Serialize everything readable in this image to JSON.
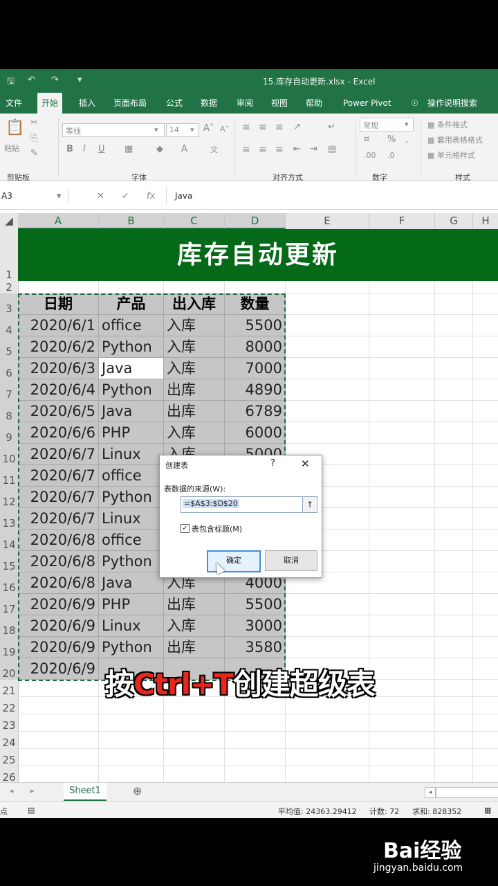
{
  "window": {
    "title": "15.库存自动更新.xlsx - Excel"
  },
  "tabs": [
    "文件",
    "开始",
    "插入",
    "页面布局",
    "公式",
    "数据",
    "审阅",
    "视图",
    "帮助",
    "Power Pivot",
    "操作说明搜索"
  ],
  "ribbon": {
    "font_name": "等线",
    "font_size": "14",
    "groups": [
      "剪贴板",
      "字体",
      "对齐方式",
      "数字",
      "样式"
    ],
    "paste_label": "粘贴",
    "number_format": "常规",
    "style_buttons": [
      "条件格式",
      "套用表格格式",
      "单元格样式"
    ]
  },
  "formula_bar": {
    "name_box": "A3",
    "formula": "Java"
  },
  "columns": [
    "A",
    "B",
    "C",
    "D",
    "E",
    "F",
    "G",
    "H"
  ],
  "rows": [
    "1",
    "2",
    "3",
    "4",
    "5",
    "6",
    "7",
    "8",
    "9",
    "10",
    "11",
    "12",
    "13",
    "14",
    "15",
    "16",
    "17",
    "18",
    "19",
    "20",
    "21",
    "22",
    "23",
    "24",
    "25",
    "26"
  ],
  "banner": "库存自动更新",
  "table": {
    "headers": [
      "日期",
      "产品",
      "出入库",
      "数量"
    ],
    "rows": [
      [
        "2020/6/1",
        "office",
        "入库",
        "5500"
      ],
      [
        "2020/6/2",
        "Python",
        "入库",
        "8000"
      ],
      [
        "2020/6/3",
        "Java",
        "入库",
        "7000"
      ],
      [
        "2020/6/4",
        "Python",
        "出库",
        "4890"
      ],
      [
        "2020/6/5",
        "Java",
        "出库",
        "6789"
      ],
      [
        "2020/6/6",
        "PHP",
        "入库",
        "6000"
      ],
      [
        "2020/6/7",
        "Linux",
        "入库",
        "5000"
      ],
      [
        "2020/6/7",
        "office",
        "",
        ""
      ],
      [
        "2020/6/7",
        "Python",
        "",
        ""
      ],
      [
        "2020/6/7",
        "Linux",
        "",
        ""
      ],
      [
        "2020/6/8",
        "office",
        "",
        ""
      ],
      [
        "2020/6/8",
        "Python",
        "",
        ""
      ],
      [
        "2020/6/8",
        "Java",
        "入库",
        "4000"
      ],
      [
        "2020/6/9",
        "PHP",
        "出库",
        "5500"
      ],
      [
        "2020/6/9",
        "Linux",
        "入库",
        "3000"
      ],
      [
        "2020/6/9",
        "Python",
        "出库",
        "3580"
      ],
      [
        "2020/6/9",
        "",
        "",
        ""
      ]
    ]
  },
  "dialog": {
    "title": "创建表",
    "help": "?",
    "source_label": "表数据的来源(W):",
    "source_value": "=$A$3:$D$20",
    "has_headers_label": "表包含标题(M)",
    "ok_label": "确定",
    "cancel_label": "取消"
  },
  "caption": {
    "pre": "按",
    "keys": "Ctrl+T",
    "post": "创建超级表"
  },
  "sheet": {
    "tab": "Sheet1",
    "add": "⊕"
  },
  "status": {
    "left": "点",
    "average": "平均值: 24363.29412",
    "count": "计数: 72",
    "sum": "求和: 828352"
  },
  "watermark": {
    "logo": "Bai经验",
    "url": "jingyan.baidu.com"
  },
  "colors": {
    "excel_green": "#217346",
    "banner_green": "#056a18",
    "caption_red": "#e8261c"
  }
}
